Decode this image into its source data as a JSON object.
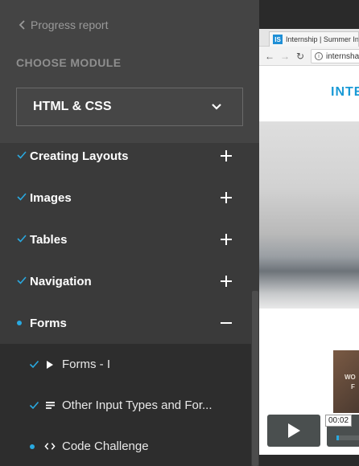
{
  "sidebar": {
    "back_label": "Progress report",
    "choose_label": "CHOOSE MODULE",
    "selected_module": "HTML & CSS",
    "modules": [
      {
        "label": "Creating Layouts",
        "status": "done",
        "toggle": "plus"
      },
      {
        "label": "Images",
        "status": "done",
        "toggle": "plus"
      },
      {
        "label": "Tables",
        "status": "done",
        "toggle": "plus"
      },
      {
        "label": "Navigation",
        "status": "done",
        "toggle": "plus"
      },
      {
        "label": "Forms",
        "status": "current",
        "toggle": "minus"
      }
    ],
    "subitems": [
      {
        "label": "Forms - I",
        "status": "done",
        "kind": "video"
      },
      {
        "label": "Other Input Types and For...",
        "status": "done",
        "kind": "text"
      },
      {
        "label": "Code Challenge",
        "status": "current",
        "kind": "code"
      }
    ]
  },
  "video": {
    "tab_title": "Internship | Summer Inte",
    "favicon_text": "IS",
    "url_text": "internsha",
    "site_logo": "INTE",
    "thumb_text_1": "WO",
    "thumb_text_2": "F",
    "time": "00:02",
    "progress_fraction": 0.02
  },
  "colors": {
    "accent": "#29a9e0",
    "sidebar_bg": "#3a3a3a",
    "sidebar_head_bg": "#444444",
    "sublist_bg": "#2d2d2d"
  }
}
